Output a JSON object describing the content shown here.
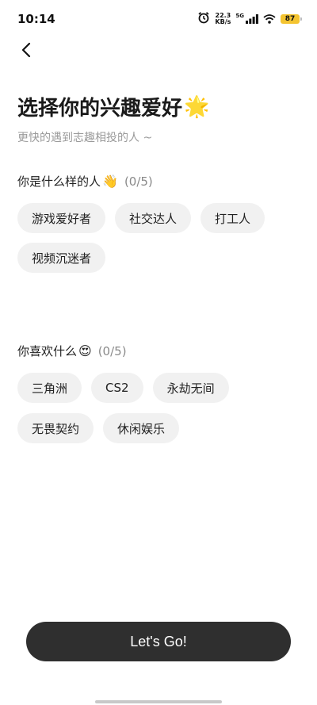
{
  "status_bar": {
    "time": "10:14",
    "net_speed_value": "22.3",
    "net_speed_unit": "KB/s",
    "network_type": "5G",
    "battery": "87"
  },
  "header": {
    "title": "选择你的兴趣爱好",
    "title_emoji": "🌟",
    "subtitle": "更快的遇到志趣相投的人 ~"
  },
  "sections": [
    {
      "heading": "你是什么样的人",
      "emoji": "👋",
      "count": "(0/5)",
      "tags": [
        "游戏爱好者",
        "社交达人",
        "打工人",
        "视频沉迷者"
      ]
    },
    {
      "heading": "你喜欢什么",
      "emoji": "😍",
      "count": "(0/5)",
      "tags": [
        "三角洲",
        "CS2",
        "永劫无间",
        "无畏契约",
        "休闲娱乐"
      ]
    }
  ],
  "footer": {
    "go_label": "Let's Go!"
  },
  "colors": {
    "chip_bg": "#f1f1f1",
    "button_bg": "#2f2f2f",
    "battery": "#f4c430"
  }
}
